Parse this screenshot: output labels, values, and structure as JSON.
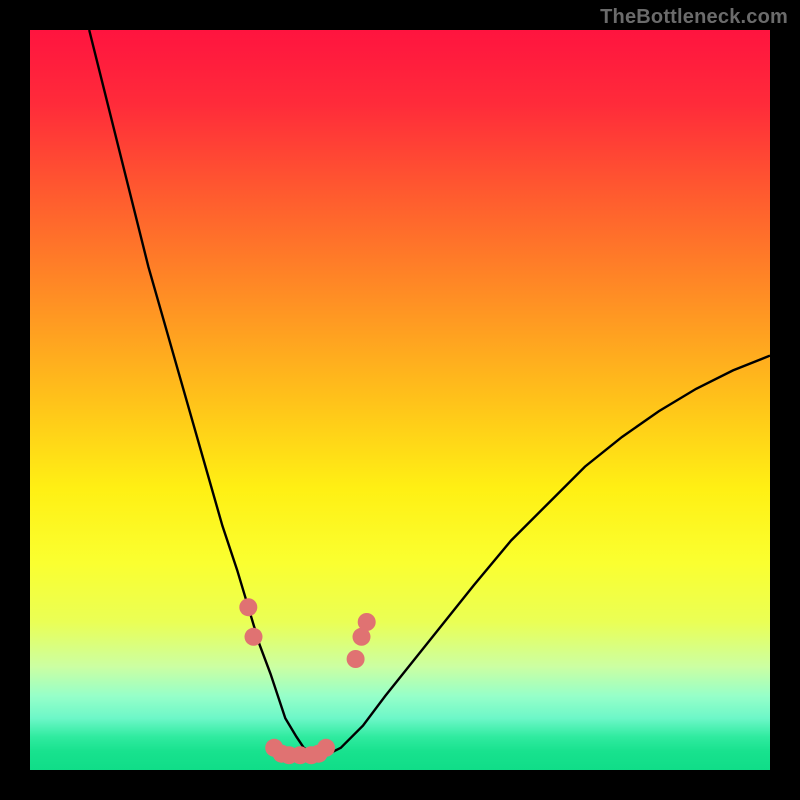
{
  "watermark": {
    "text": "TheBottleneck.com"
  },
  "gradient": {
    "stops": [
      {
        "pos": 0.0,
        "color": "#ff143f"
      },
      {
        "pos": 0.1,
        "color": "#ff2b3a"
      },
      {
        "pos": 0.22,
        "color": "#ff5a2f"
      },
      {
        "pos": 0.35,
        "color": "#ff8a25"
      },
      {
        "pos": 0.5,
        "color": "#ffc21a"
      },
      {
        "pos": 0.62,
        "color": "#fff014"
      },
      {
        "pos": 0.72,
        "color": "#faff30"
      },
      {
        "pos": 0.8,
        "color": "#eaff55"
      },
      {
        "pos": 0.86,
        "color": "#ccffa2"
      },
      {
        "pos": 0.9,
        "color": "#96ffc9"
      },
      {
        "pos": 0.93,
        "color": "#6df7c8"
      },
      {
        "pos": 0.955,
        "color": "#30eba0"
      },
      {
        "pos": 0.975,
        "color": "#18e28e"
      },
      {
        "pos": 1.0,
        "color": "#10dd88"
      }
    ]
  },
  "chart_data": {
    "type": "line",
    "title": "",
    "xlabel": "",
    "ylabel": "",
    "xlim": [
      0,
      100
    ],
    "ylim": [
      0,
      100
    ],
    "series": [
      {
        "name": "bottleneck-curve",
        "x": [
          8,
          10,
          12,
          14,
          16,
          18,
          20,
          22,
          24,
          26,
          28,
          29.5,
          31,
          32.5,
          33.5,
          34.5,
          36,
          37,
          38.5,
          40,
          42,
          45,
          48,
          52,
          56,
          60,
          65,
          70,
          75,
          80,
          85,
          90,
          95,
          100
        ],
        "y": [
          100,
          92,
          84,
          76,
          68,
          61,
          54,
          47,
          40,
          33,
          27,
          22,
          17,
          13,
          10,
          7,
          4.5,
          3,
          2,
          2,
          3,
          6,
          10,
          15,
          20,
          25,
          31,
          36,
          41,
          45,
          48.5,
          51.5,
          54,
          56
        ]
      }
    ],
    "markers": {
      "name": "highlight-dots",
      "color": "#e07272",
      "points": [
        {
          "x": 29.5,
          "y": 22
        },
        {
          "x": 30.2,
          "y": 18
        },
        {
          "x": 33.0,
          "y": 3
        },
        {
          "x": 34.0,
          "y": 2.2
        },
        {
          "x": 35.0,
          "y": 2
        },
        {
          "x": 36.5,
          "y": 2
        },
        {
          "x": 38.0,
          "y": 2
        },
        {
          "x": 39.0,
          "y": 2.2
        },
        {
          "x": 40.0,
          "y": 3
        },
        {
          "x": 44.0,
          "y": 15
        },
        {
          "x": 44.8,
          "y": 18
        },
        {
          "x": 45.5,
          "y": 20
        }
      ]
    }
  }
}
